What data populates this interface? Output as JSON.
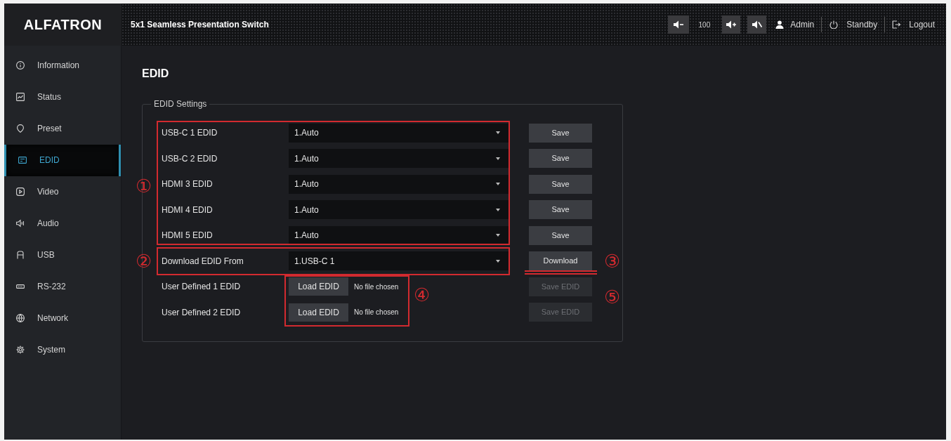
{
  "header": {
    "logo": "ALFATRON",
    "title": "5x1 Seamless Presentation Switch",
    "volume": "100",
    "user": "Admin",
    "standby": "Standby",
    "logout": "Logout"
  },
  "sidebar": {
    "items": [
      {
        "label": "Information",
        "selected": false
      },
      {
        "label": "Status",
        "selected": false
      },
      {
        "label": "Preset",
        "selected": false
      },
      {
        "label": "EDID",
        "selected": true
      },
      {
        "label": "Video",
        "selected": false
      },
      {
        "label": "Audio",
        "selected": false
      },
      {
        "label": "USB",
        "selected": false
      },
      {
        "label": "RS-232",
        "selected": false
      },
      {
        "label": "Network",
        "selected": false
      },
      {
        "label": "System",
        "selected": false
      }
    ]
  },
  "content": {
    "title": "EDID",
    "panel": {
      "legend": "EDID Settings",
      "rows": [
        {
          "kind": "select",
          "label": "USB-C 1 EDID",
          "value": "1.Auto",
          "button": {
            "label": "Save",
            "disabled": false
          }
        },
        {
          "kind": "select",
          "label": "USB-C 2 EDID",
          "value": "1.Auto",
          "button": {
            "label": "Save",
            "disabled": false
          }
        },
        {
          "kind": "select",
          "label": "HDMI 3 EDID",
          "value": "1.Auto",
          "button": {
            "label": "Save",
            "disabled": false
          }
        },
        {
          "kind": "select",
          "label": "HDMI 4 EDID",
          "value": "1.Auto",
          "button": {
            "label": "Save",
            "disabled": false
          }
        },
        {
          "kind": "select",
          "label": "HDMI 5 EDID",
          "value": "1.Auto",
          "button": {
            "label": "Save",
            "disabled": false
          }
        },
        {
          "kind": "select",
          "label": "Download EDID From",
          "value": "1.USB-C 1",
          "button": {
            "label": "Download",
            "disabled": false
          }
        },
        {
          "kind": "file",
          "label": "User Defined 1 EDID",
          "file_button": "Load EDID",
          "file_status": "No file chosen",
          "button": {
            "label": "Save EDID",
            "disabled": true
          }
        },
        {
          "kind": "file",
          "label": "User Defined 2 EDID",
          "file_button": "Load EDID",
          "file_status": "No file chosen",
          "button": {
            "label": "Save EDID",
            "disabled": true
          }
        }
      ]
    }
  },
  "annotations": {
    "callouts": [
      {
        "label": "①"
      },
      {
        "label": "②"
      },
      {
        "label": "③"
      },
      {
        "label": "④"
      },
      {
        "label": "⑤"
      }
    ]
  }
}
